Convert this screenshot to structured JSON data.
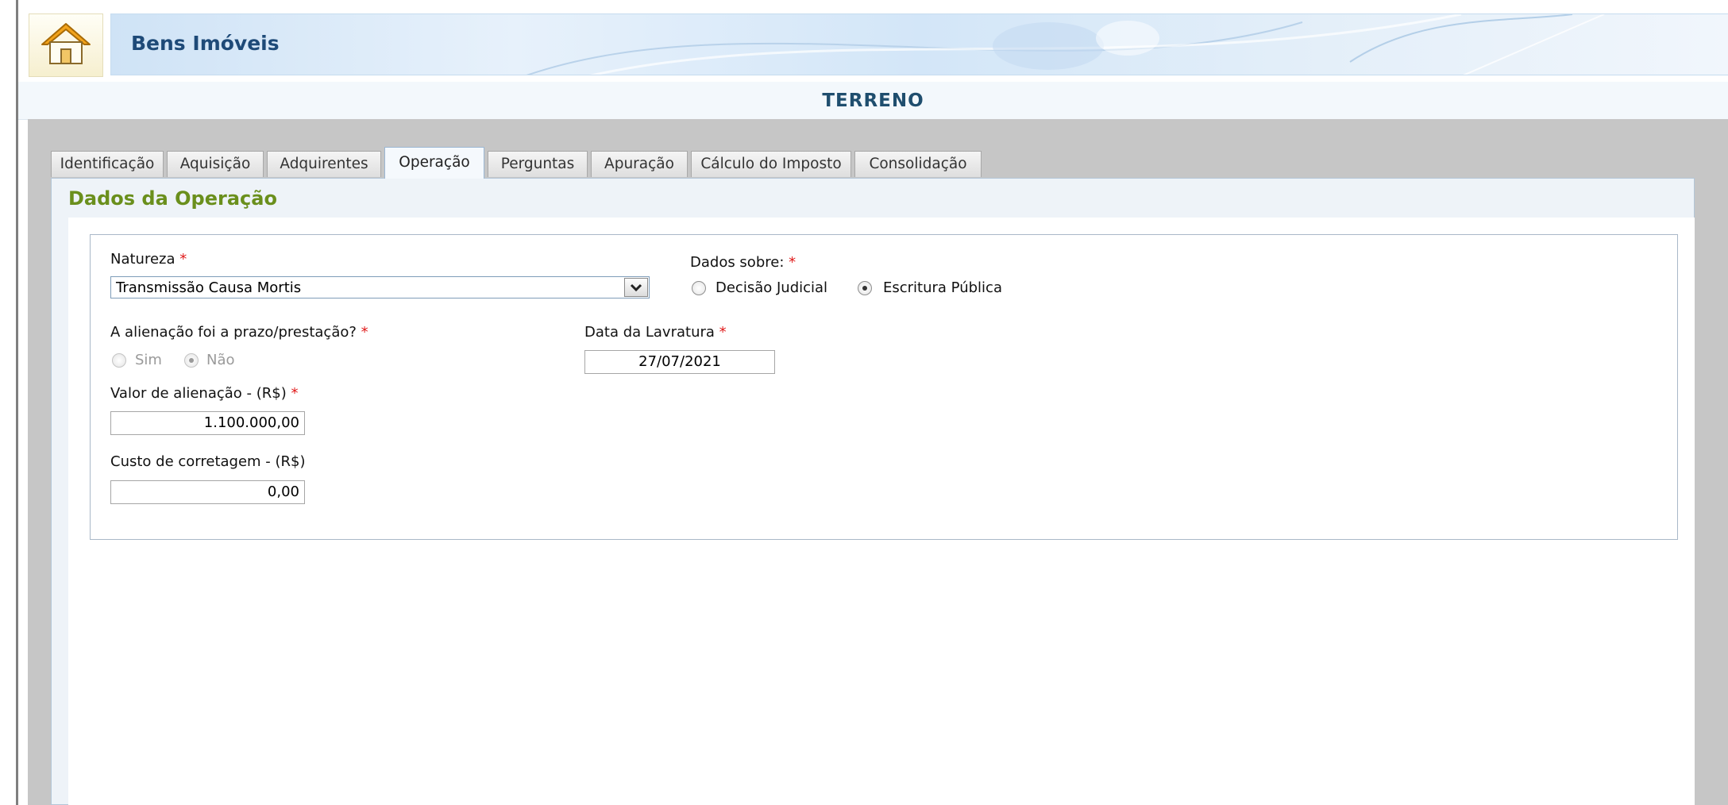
{
  "header": {
    "app_title": "Bens Imóveis",
    "page_title": "TERRENO",
    "home_icon": "home-icon"
  },
  "tabs": [
    {
      "label": "Identificação",
      "active": false
    },
    {
      "label": "Aquisição",
      "active": false
    },
    {
      "label": "Adquirentes",
      "active": false
    },
    {
      "label": "Operação",
      "active": true
    },
    {
      "label": "Perguntas",
      "active": false
    },
    {
      "label": "Apuração",
      "active": false
    },
    {
      "label": "Cálculo do Imposto",
      "active": false
    },
    {
      "label": "Consolidação",
      "active": false
    }
  ],
  "section": {
    "title": "Dados da Operação"
  },
  "form": {
    "natureza": {
      "label": "Natureza",
      "required_mark": "*",
      "value": "Transmissão Causa Mortis"
    },
    "dados_sobre": {
      "label": "Dados sobre:",
      "required_mark": "*",
      "options": [
        "Decisão Judicial",
        "Escritura Pública"
      ],
      "selected": "Escritura Pública"
    },
    "alienacao_prazo": {
      "label": "A alienação foi a prazo/prestação?",
      "required_mark": "*",
      "options": [
        "Sim",
        "Não"
      ],
      "selected": "Não",
      "disabled": true
    },
    "data_lavratura": {
      "label": "Data da Lavratura",
      "required_mark": "*",
      "value": "27/07/2021"
    },
    "valor_alienacao": {
      "label": "Valor de alienação - (R$)",
      "required_mark": "*",
      "value": "1.100.000,00"
    },
    "custo_corretagem": {
      "label": "Custo de corretagem - (R$)",
      "value": "0,00"
    }
  },
  "colors": {
    "section_title": "#6a8f1c",
    "page_title": "#1f4e6e",
    "app_title": "#1e4a78",
    "required": "#e01a1a"
  }
}
